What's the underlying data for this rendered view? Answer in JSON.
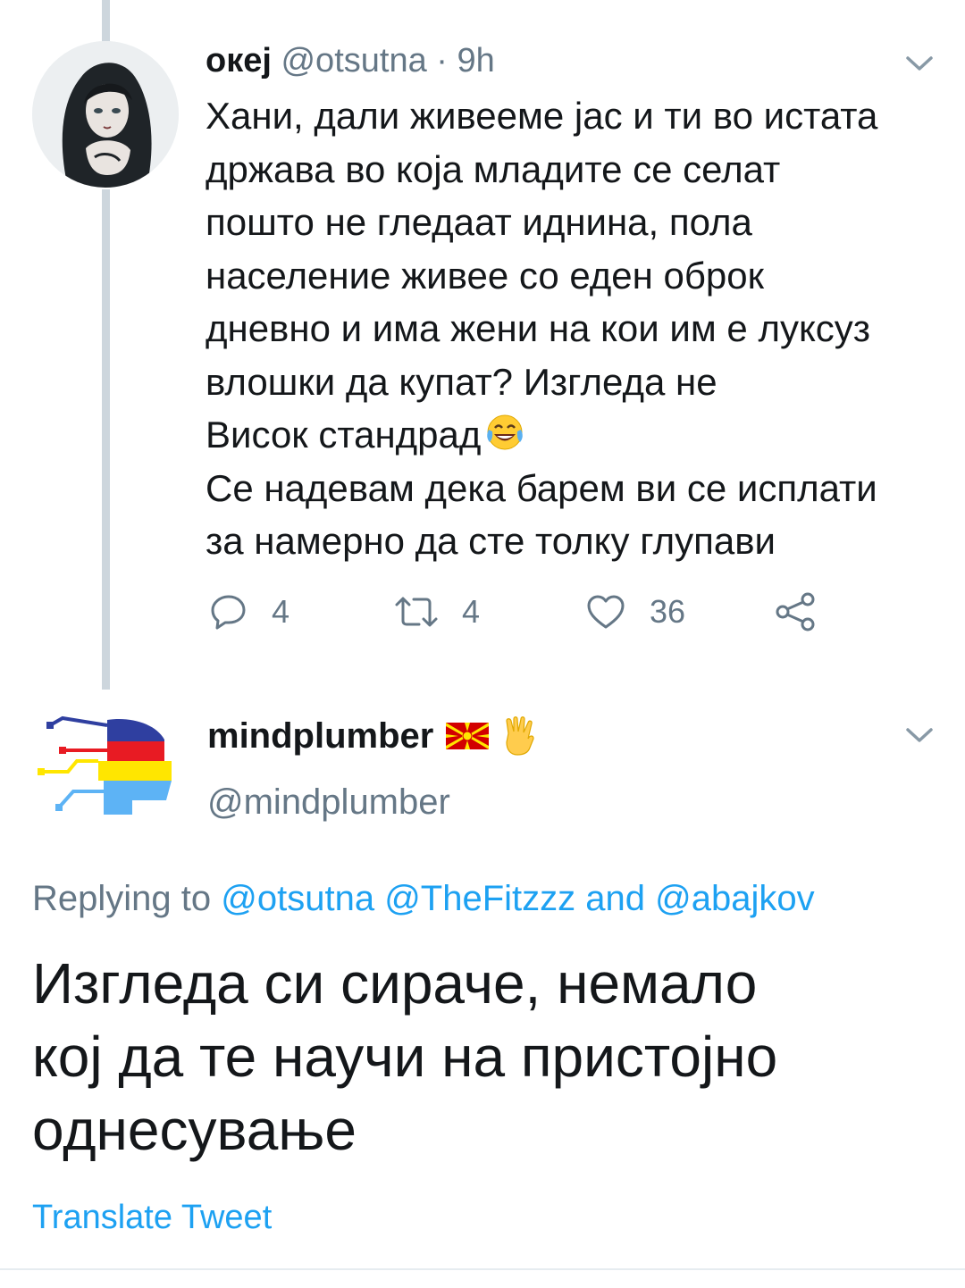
{
  "tweet1": {
    "name": "океј",
    "handle": "@otsutna",
    "dot": "·",
    "time": "9h",
    "avatar_icon": "woman-illustration-avatar",
    "lines": [
      "Хани, дали живееме јас и ти во истата",
      "држава во која младите се селат",
      "пошто не гледаат иднина, пола",
      "население живее со еден оброк",
      "дневно и има жени на кои им е луксуз",
      "влошки да купат? Изгледа не",
      "Висок стандрад",
      "Се надевам дека барем ви се исплати",
      "за намерно да сте толку глупави"
    ],
    "emoji": "face-with-tears-of-joy",
    "actions": {
      "replies": "4",
      "retweets": "4",
      "likes": "36"
    }
  },
  "tweet2": {
    "name": "mindplumber",
    "handle": "@mindplumber",
    "avatar_icon": "circuit-head-logo",
    "name_emojis": [
      "north-macedonia-flag",
      "vulcan-salute"
    ],
    "replying_prefix": "Replying to",
    "mention1": "@otsutna",
    "mention2": "@TheFitzzz",
    "and": "and",
    "mention3": "@abajkov",
    "lines": [
      "Изгледа си сираче, немало",
      "кој да те научи на пристојно",
      "однесување"
    ],
    "translate": "Translate Tweet"
  },
  "colors": {
    "text": "#14171a",
    "secondary": "#657786",
    "link": "#1da1f2",
    "thread_line": "#cdd6dd"
  }
}
